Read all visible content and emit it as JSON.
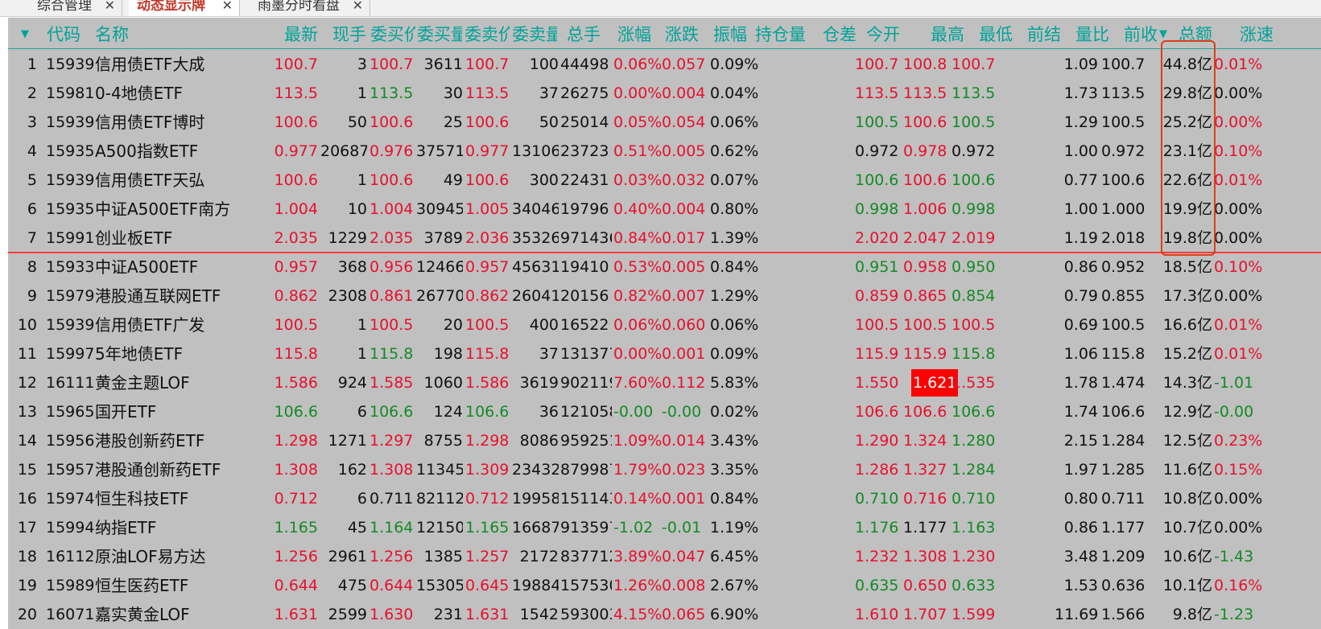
{
  "tabs": [
    {
      "label": "综合管理",
      "active": false
    },
    {
      "label": "动态显示牌",
      "active": true
    },
    {
      "label": "雨墨分时看盘",
      "active": false
    }
  ],
  "icons": {
    "close": "close-icon",
    "menu": "caret-down-icon",
    "sort": "sort-desc-icon"
  },
  "colors": {
    "up": "#e8102e",
    "down": "#138a25",
    "header": "#00a399",
    "board_bg": "#c0c0c0",
    "highlight": "#ff0000",
    "frame": "#d9401c"
  },
  "columns": [
    "代码",
    "名称",
    "最新",
    "现手",
    "委买价",
    "委买量",
    "委卖价",
    "委卖量",
    "总手",
    "涨幅",
    "涨跌",
    "振幅",
    "持仓量",
    "仓差",
    "今开",
    "最高",
    "最低",
    "前结",
    "量比",
    "前收",
    "总额",
    "涨速"
  ],
  "header_visible": [
    "代码",
    "名称",
    "最新",
    "现手",
    "委买价",
    "委买量",
    "委卖价",
    "委卖量",
    "总手",
    "涨幅",
    "涨跌",
    "振幅",
    "持仓量",
    "仓差",
    "今开",
    "最高",
    "最低",
    "前结",
    "量比",
    "前收",
    "总额",
    "涨速"
  ],
  "sort_column": "总额",
  "rows": [
    {
      "no": "1",
      "code": "15939",
      "name": "信用债ETF大成",
      "last": "100.7",
      "last_c": "up",
      "vol": "3",
      "bid": "100.7",
      "bid_c": "up",
      "bidvol": "3611",
      "ask": "100.7",
      "ask_c": "up",
      "askvol": "100",
      "total": "44498",
      "chg": "0.06%",
      "chg_c": "up",
      "diff": "0.057",
      "diff_c": "up",
      "amp": "0.09%",
      "open": "100.7",
      "open_c": "up",
      "high": "100.8",
      "high_c": "up",
      "low": "100.7",
      "low_c": "up",
      "ratio": "1.09",
      "prev": "100.7",
      "amount": "44.8亿",
      "speed": "0.01%",
      "speed_c": "up"
    },
    {
      "no": "2",
      "code": "15981",
      "name": "0-4地债ETF",
      "last": "113.5",
      "last_c": "up",
      "vol": "1",
      "bid": "113.5",
      "bid_c": "down",
      "bidvol": "30",
      "ask": "113.5",
      "ask_c": "up",
      "askvol": "37",
      "total": "26275",
      "chg": "0.00%",
      "chg_c": "up",
      "diff": "0.004",
      "diff_c": "up",
      "amp": "0.04%",
      "open": "113.5",
      "open_c": "up",
      "high": "113.5",
      "high_c": "up",
      "low": "113.5",
      "low_c": "down",
      "ratio": "1.73",
      "prev": "113.5",
      "amount": "29.8亿",
      "speed": "0.00%",
      "speed_c": "flat"
    },
    {
      "no": "3",
      "code": "15939",
      "name": "信用债ETF博时",
      "last": "100.6",
      "last_c": "up",
      "vol": "50",
      "bid": "100.6",
      "bid_c": "up",
      "bidvol": "25",
      "ask": "100.6",
      "ask_c": "up",
      "askvol": "50",
      "total": "25014",
      "chg": "0.05%",
      "chg_c": "up",
      "diff": "0.054",
      "diff_c": "up",
      "amp": "0.06%",
      "open": "100.5",
      "open_c": "down",
      "high": "100.6",
      "high_c": "up",
      "low": "100.5",
      "low_c": "down",
      "ratio": "1.29",
      "prev": "100.5",
      "amount": "25.2亿",
      "speed": "0.00%",
      "speed_c": "up"
    },
    {
      "no": "4",
      "code": "15935",
      "name": "A500指数ETF",
      "last": "0.977",
      "last_c": "up",
      "vol": "20687",
      "bid": "0.976",
      "bid_c": "up",
      "bidvol": "37571",
      "ask": "0.977",
      "ask_c": "up",
      "askvol": "13106",
      "total": "23723",
      "chg": "0.51%",
      "chg_c": "up",
      "diff": "0.005",
      "diff_c": "up",
      "amp": "0.62%",
      "open": "0.972",
      "open_c": "flat",
      "high": "0.978",
      "high_c": "up",
      "low": "0.972",
      "low_c": "flat",
      "ratio": "1.00",
      "prev": "0.972",
      "amount": "23.1亿",
      "speed": "0.10%",
      "speed_c": "up"
    },
    {
      "no": "5",
      "code": "15939",
      "name": "信用债ETF天弘",
      "last": "100.6",
      "last_c": "up",
      "vol": "1",
      "bid": "100.6",
      "bid_c": "up",
      "bidvol": "49",
      "ask": "100.6",
      "ask_c": "up",
      "askvol": "300",
      "total": "22431",
      "chg": "0.03%",
      "chg_c": "up",
      "diff": "0.032",
      "diff_c": "up",
      "amp": "0.07%",
      "open": "100.6",
      "open_c": "down",
      "high": "100.6",
      "high_c": "up",
      "low": "100.6",
      "low_c": "down",
      "ratio": "0.77",
      "prev": "100.6",
      "amount": "22.6亿",
      "speed": "0.01%",
      "speed_c": "up"
    },
    {
      "no": "6",
      "code": "15935",
      "name": "中证A500ETF南方",
      "last": "1.004",
      "last_c": "up",
      "vol": "10",
      "bid": "1.004",
      "bid_c": "up",
      "bidvol": "30945",
      "ask": "1.005",
      "ask_c": "up",
      "askvol": "34046",
      "total": "19796",
      "chg": "0.40%",
      "chg_c": "up",
      "diff": "0.004",
      "diff_c": "up",
      "amp": "0.80%",
      "open": "0.998",
      "open_c": "down",
      "high": "1.006",
      "high_c": "up",
      "low": "0.998",
      "low_c": "down",
      "ratio": "1.00",
      "prev": "1.000",
      "amount": "19.9亿",
      "speed": "0.00%",
      "speed_c": "flat"
    },
    {
      "no": "7",
      "code": "15991",
      "name": "创业板ETF",
      "last": "2.035",
      "last_c": "up",
      "vol": "1229",
      "bid": "2.035",
      "bid_c": "up",
      "bidvol": "3789",
      "ask": "2.036",
      "ask_c": "up",
      "askvol": "35326",
      "total": "971436",
      "chg": "0.84%",
      "chg_c": "up",
      "diff": "0.017",
      "diff_c": "up",
      "amp": "1.39%",
      "open": "2.020",
      "open_c": "up",
      "high": "2.047",
      "high_c": "up",
      "low": "2.019",
      "low_c": "up",
      "ratio": "1.19",
      "prev": "2.018",
      "amount": "19.8亿",
      "speed": "0.00%",
      "speed_c": "flat"
    },
    {
      "no": "8",
      "code": "15933",
      "name": "中证A500ETF",
      "last": "0.957",
      "last_c": "up",
      "vol": "368",
      "bid": "0.956",
      "bid_c": "up",
      "bidvol": "12466",
      "ask": "0.957",
      "ask_c": "up",
      "askvol": "45631",
      "total": "19410",
      "chg": "0.53%",
      "chg_c": "up",
      "diff": "0.005",
      "diff_c": "up",
      "amp": "0.84%",
      "open": "0.951",
      "open_c": "down",
      "high": "0.958",
      "high_c": "up",
      "low": "0.950",
      "low_c": "down",
      "ratio": "0.86",
      "prev": "0.952",
      "amount": "18.5亿",
      "speed": "0.10%",
      "speed_c": "up"
    },
    {
      "no": "9",
      "code": "15979",
      "name": "港股通互联网ETF",
      "last": "0.862",
      "last_c": "up",
      "vol": "2308",
      "bid": "0.861",
      "bid_c": "up",
      "bidvol": "26770",
      "ask": "0.862",
      "ask_c": "up",
      "askvol": "26041",
      "total": "20156",
      "chg": "0.82%",
      "chg_c": "up",
      "diff": "0.007",
      "diff_c": "up",
      "amp": "1.29%",
      "open": "0.859",
      "open_c": "up",
      "high": "0.865",
      "high_c": "up",
      "low": "0.854",
      "low_c": "down",
      "ratio": "0.79",
      "prev": "0.855",
      "amount": "17.3亿",
      "speed": "0.00%",
      "speed_c": "flat"
    },
    {
      "no": "10",
      "code": "15939",
      "name": "信用债ETF广发",
      "last": "100.5",
      "last_c": "up",
      "vol": "1",
      "bid": "100.5",
      "bid_c": "up",
      "bidvol": "20",
      "ask": "100.5",
      "ask_c": "up",
      "askvol": "400",
      "total": "16522",
      "chg": "0.06%",
      "chg_c": "up",
      "diff": "0.060",
      "diff_c": "up",
      "amp": "0.06%",
      "open": "100.5",
      "open_c": "up",
      "high": "100.5",
      "high_c": "up",
      "low": "100.5",
      "low_c": "up",
      "ratio": "0.69",
      "prev": "100.5",
      "amount": "16.6亿",
      "speed": "0.01%",
      "speed_c": "up"
    },
    {
      "no": "11",
      "code": "15997",
      "name": "5年地债ETF",
      "last": "115.8",
      "last_c": "up",
      "vol": "1",
      "bid": "115.8",
      "bid_c": "down",
      "bidvol": "198",
      "ask": "115.8",
      "ask_c": "up",
      "askvol": "37",
      "total": "131377",
      "chg": "0.00%",
      "chg_c": "up",
      "diff": "0.001",
      "diff_c": "up",
      "amp": "0.09%",
      "open": "115.9",
      "open_c": "up",
      "high": "115.9",
      "high_c": "up",
      "low": "115.8",
      "low_c": "down",
      "ratio": "1.06",
      "prev": "115.8",
      "amount": "15.2亿",
      "speed": "0.01%",
      "speed_c": "up"
    },
    {
      "no": "12",
      "code": "16111",
      "name": "黄金主题LOF",
      "last": "1.586",
      "last_c": "up",
      "vol": "924",
      "bid": "1.585",
      "bid_c": "up",
      "bidvol": "1060",
      "ask": "1.586",
      "ask_c": "up",
      "askvol": "3619",
      "total": "902119",
      "chg": "7.60%",
      "chg_c": "up",
      "diff": "0.112",
      "diff_c": "up",
      "amp": "5.83%",
      "open": "1.550",
      "open_c": "up",
      "high": "1.621",
      "high_c": "hl",
      "low": "1.535",
      "low_c": "up",
      "ratio": "1.78",
      "prev": "1.474",
      "amount": "14.3亿",
      "speed": "-1.01",
      "speed_c": "down"
    },
    {
      "no": "13",
      "code": "15965",
      "name": "国开ETF",
      "last": "106.6",
      "last_c": "down",
      "vol": "6",
      "bid": "106.6",
      "bid_c": "down",
      "bidvol": "124",
      "ask": "106.6",
      "ask_c": "down",
      "askvol": "36",
      "total": "121058",
      "chg": "-0.00",
      "chg_c": "down",
      "diff": "-0.00",
      "diff_c": "down",
      "amp": "0.02%",
      "open": "106.6",
      "open_c": "up",
      "high": "106.6",
      "high_c": "up",
      "low": "106.6",
      "low_c": "down",
      "ratio": "1.74",
      "prev": "106.6",
      "amount": "12.9亿",
      "speed": "-0.00",
      "speed_c": "down"
    },
    {
      "no": "14",
      "code": "15956",
      "name": "港股创新药ETF",
      "last": "1.298",
      "last_c": "up",
      "vol": "1271",
      "bid": "1.297",
      "bid_c": "up",
      "bidvol": "8755",
      "ask": "1.298",
      "ask_c": "up",
      "askvol": "8086",
      "total": "959251",
      "chg": "1.09%",
      "chg_c": "up",
      "diff": "0.014",
      "diff_c": "up",
      "amp": "3.43%",
      "open": "1.290",
      "open_c": "up",
      "high": "1.324",
      "high_c": "up",
      "low": "1.280",
      "low_c": "down",
      "ratio": "2.15",
      "prev": "1.284",
      "amount": "12.5亿",
      "speed": "0.23%",
      "speed_c": "up"
    },
    {
      "no": "15",
      "code": "15957",
      "name": "港股通创新药ETF",
      "last": "1.308",
      "last_c": "up",
      "vol": "162",
      "bid": "1.308",
      "bid_c": "up",
      "bidvol": "11345",
      "ask": "1.309",
      "ask_c": "up",
      "askvol": "23432",
      "total": "879987",
      "chg": "1.79%",
      "chg_c": "up",
      "diff": "0.023",
      "diff_c": "up",
      "amp": "3.35%",
      "open": "1.286",
      "open_c": "up",
      "high": "1.327",
      "high_c": "up",
      "low": "1.284",
      "low_c": "down",
      "ratio": "1.97",
      "prev": "1.285",
      "amount": "11.6亿",
      "speed": "0.15%",
      "speed_c": "up"
    },
    {
      "no": "16",
      "code": "15974",
      "name": "恒生科技ETF",
      "last": "0.712",
      "last_c": "up",
      "vol": "6",
      "bid": "0.711",
      "bid_c": "flat",
      "bidvol": "82112",
      "ask": "0.712",
      "ask_c": "up",
      "askvol": "19958",
      "total": "151143",
      "chg": "0.14%",
      "chg_c": "up",
      "diff": "0.001",
      "diff_c": "up",
      "amp": "0.84%",
      "open": "0.710",
      "open_c": "down",
      "high": "0.716",
      "high_c": "up",
      "low": "0.710",
      "low_c": "down",
      "ratio": "0.80",
      "prev": "0.711",
      "amount": "10.8亿",
      "speed": "0.00%",
      "speed_c": "flat"
    },
    {
      "no": "17",
      "code": "15994",
      "name": "纳指ETF",
      "last": "1.165",
      "last_c": "down",
      "vol": "45",
      "bid": "1.164",
      "bid_c": "down",
      "bidvol": "12150",
      "ask": "1.165",
      "ask_c": "down",
      "askvol": "16687",
      "total": "913597",
      "chg": "-1.02",
      "chg_c": "down",
      "diff": "-0.01",
      "diff_c": "down",
      "amp": "1.19%",
      "open": "1.176",
      "open_c": "down",
      "high": "1.177",
      "high_c": "flat",
      "low": "1.163",
      "low_c": "down",
      "ratio": "0.86",
      "prev": "1.177",
      "amount": "10.7亿",
      "speed": "0.00%",
      "speed_c": "flat"
    },
    {
      "no": "18",
      "code": "16112",
      "name": "原油LOF易方达",
      "last": "1.256",
      "last_c": "up",
      "vol": "2961",
      "bid": "1.256",
      "bid_c": "up",
      "bidvol": "1385",
      "ask": "1.257",
      "ask_c": "up",
      "askvol": "2172",
      "total": "837712",
      "chg": "3.89%",
      "chg_c": "up",
      "diff": "0.047",
      "diff_c": "up",
      "amp": "6.45%",
      "open": "1.232",
      "open_c": "up",
      "high": "1.308",
      "high_c": "up",
      "low": "1.230",
      "low_c": "up",
      "ratio": "3.48",
      "prev": "1.209",
      "amount": "10.6亿",
      "speed": "-1.43",
      "speed_c": "down"
    },
    {
      "no": "19",
      "code": "15989",
      "name": "恒生医药ETF",
      "last": "0.644",
      "last_c": "up",
      "vol": "475",
      "bid": "0.644",
      "bid_c": "up",
      "bidvol": "15305",
      "ask": "0.645",
      "ask_c": "up",
      "askvol": "19884",
      "total": "157530",
      "chg": "1.26%",
      "chg_c": "up",
      "diff": "0.008",
      "diff_c": "up",
      "amp": "2.67%",
      "open": "0.635",
      "open_c": "down",
      "high": "0.650",
      "high_c": "up",
      "low": "0.633",
      "low_c": "down",
      "ratio": "1.53",
      "prev": "0.636",
      "amount": "10.1亿",
      "speed": "0.16%",
      "speed_c": "up"
    },
    {
      "no": "20",
      "code": "16071",
      "name": "嘉实黄金LOF",
      "last": "1.631",
      "last_c": "up",
      "vol": "2599",
      "bid": "1.630",
      "bid_c": "up",
      "bidvol": "231",
      "ask": "1.631",
      "ask_c": "up",
      "askvol": "1542",
      "total": "593003",
      "chg": "4.15%",
      "chg_c": "up",
      "diff": "0.065",
      "diff_c": "up",
      "amp": "6.90%",
      "open": "1.610",
      "open_c": "up",
      "high": "1.707",
      "high_c": "up",
      "low": "1.599",
      "low_c": "up",
      "ratio": "11.69",
      "prev": "1.566",
      "amount": "9.8亿",
      "speed": "-1.23",
      "speed_c": "down"
    }
  ]
}
